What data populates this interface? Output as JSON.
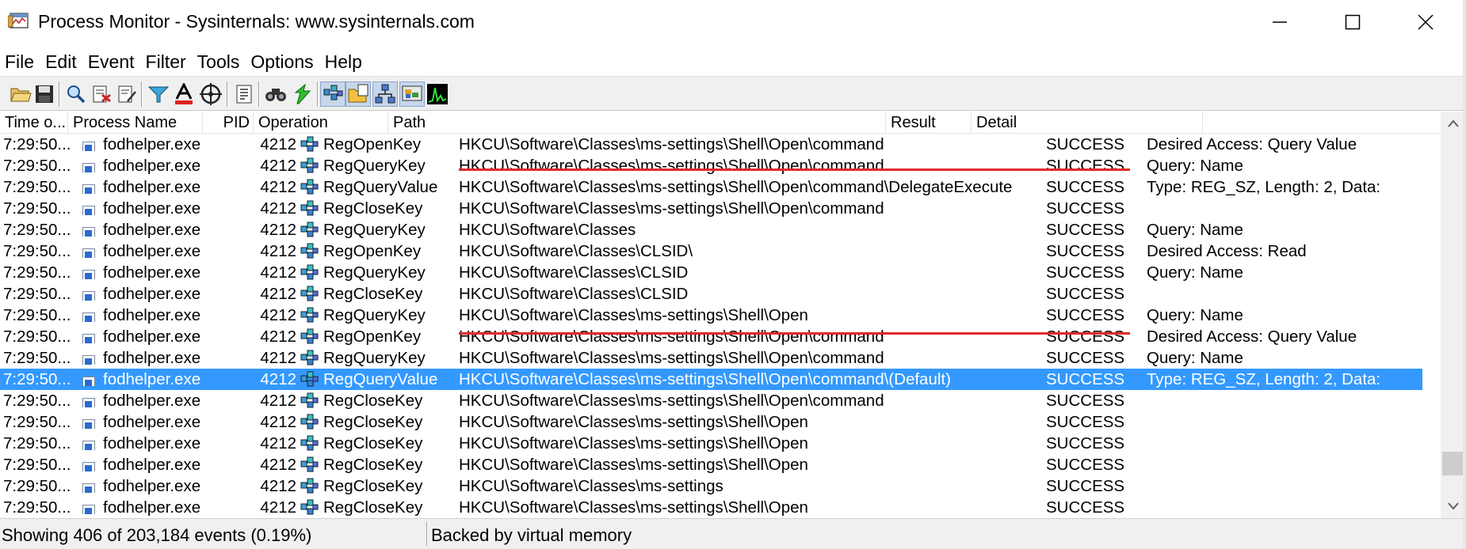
{
  "window": {
    "title": "Process Monitor - Sysinternals: www.sysinternals.com",
    "icon": "process-monitor-icon"
  },
  "menu": [
    "File",
    "Edit",
    "Event",
    "Filter",
    "Tools",
    "Options",
    "Help"
  ],
  "toolbar": {
    "buttons": [
      "open-icon",
      "save-icon",
      "capture-icon",
      "autoscroll-icon",
      "clear-icon",
      "filter-icon",
      "highlight-icon",
      "include-process-icon",
      "tree-icon",
      "find-icon",
      "jump-icon",
      "registry-activity-icon",
      "file-activity-icon",
      "network-activity-icon",
      "process-activity-icon",
      "profiling-icon"
    ]
  },
  "columns": {
    "time": "Time o...",
    "process": "Process Name",
    "pid": "PID",
    "operation": "Operation",
    "path": "Path",
    "result": "Result",
    "detail": "Detail"
  },
  "rows": [
    {
      "time": "7:29:50...",
      "process": "fodhelper.exe",
      "pid": "4212",
      "operation": "RegOpenKey",
      "path": "HKCU\\Software\\Classes\\ms-settings\\Shell\\Open\\command",
      "result": "SUCCESS",
      "detail": "Desired Access: Query Value"
    },
    {
      "time": "7:29:50...",
      "process": "fodhelper.exe",
      "pid": "4212",
      "operation": "RegQueryKey",
      "path": "HKCU\\Software\\Classes\\ms-settings\\Shell\\Open\\command",
      "result": "SUCCESS",
      "detail": "Query: Name"
    },
    {
      "time": "7:29:50...",
      "process": "fodhelper.exe",
      "pid": "4212",
      "operation": "RegQueryValue",
      "path": "HKCU\\Software\\Classes\\ms-settings\\Shell\\Open\\command\\DelegateExecute",
      "result": "SUCCESS",
      "detail": "Type: REG_SZ, Length: 2, Data:"
    },
    {
      "time": "7:29:50...",
      "process": "fodhelper.exe",
      "pid": "4212",
      "operation": "RegCloseKey",
      "path": "HKCU\\Software\\Classes\\ms-settings\\Shell\\Open\\command",
      "result": "SUCCESS",
      "detail": ""
    },
    {
      "time": "7:29:50...",
      "process": "fodhelper.exe",
      "pid": "4212",
      "operation": "RegQueryKey",
      "path": "HKCU\\Software\\Classes",
      "result": "SUCCESS",
      "detail": "Query: Name"
    },
    {
      "time": "7:29:50...",
      "process": "fodhelper.exe",
      "pid": "4212",
      "operation": "RegOpenKey",
      "path": "HKCU\\Software\\Classes\\CLSID\\",
      "result": "SUCCESS",
      "detail": "Desired Access: Read"
    },
    {
      "time": "7:29:50...",
      "process": "fodhelper.exe",
      "pid": "4212",
      "operation": "RegQueryKey",
      "path": "HKCU\\Software\\Classes\\CLSID",
      "result": "SUCCESS",
      "detail": "Query: Name"
    },
    {
      "time": "7:29:50...",
      "process": "fodhelper.exe",
      "pid": "4212",
      "operation": "RegCloseKey",
      "path": "HKCU\\Software\\Classes\\CLSID",
      "result": "SUCCESS",
      "detail": ""
    },
    {
      "time": "7:29:50...",
      "process": "fodhelper.exe",
      "pid": "4212",
      "operation": "RegQueryKey",
      "path": "HKCU\\Software\\Classes\\ms-settings\\Shell\\Open",
      "result": "SUCCESS",
      "detail": "Query: Name"
    },
    {
      "time": "7:29:50...",
      "process": "fodhelper.exe",
      "pid": "4212",
      "operation": "RegOpenKey",
      "path": "HKCU\\Software\\Classes\\ms-settings\\Shell\\Open\\command",
      "result": "SUCCESS",
      "detail": "Desired Access: Query Value"
    },
    {
      "time": "7:29:50...",
      "process": "fodhelper.exe",
      "pid": "4212",
      "operation": "RegQueryKey",
      "path": "HKCU\\Software\\Classes\\ms-settings\\Shell\\Open\\command",
      "result": "SUCCESS",
      "detail": "Query: Name"
    },
    {
      "time": "7:29:50...",
      "process": "fodhelper.exe",
      "pid": "4212",
      "operation": "RegQueryValue",
      "path": "HKCU\\Software\\Classes\\ms-settings\\Shell\\Open\\command\\(Default)",
      "result": "SUCCESS",
      "detail": "Type: REG_SZ, Length: 2, Data:",
      "selected": true
    },
    {
      "time": "7:29:50...",
      "process": "fodhelper.exe",
      "pid": "4212",
      "operation": "RegCloseKey",
      "path": "HKCU\\Software\\Classes\\ms-settings\\Shell\\Open\\command",
      "result": "SUCCESS",
      "detail": ""
    },
    {
      "time": "7:29:50...",
      "process": "fodhelper.exe",
      "pid": "4212",
      "operation": "RegCloseKey",
      "path": "HKCU\\Software\\Classes\\ms-settings\\Shell\\Open",
      "result": "SUCCESS",
      "detail": ""
    },
    {
      "time": "7:29:50...",
      "process": "fodhelper.exe",
      "pid": "4212",
      "operation": "RegCloseKey",
      "path": "HKCU\\Software\\Classes\\ms-settings\\Shell\\Open",
      "result": "SUCCESS",
      "detail": ""
    },
    {
      "time": "7:29:50...",
      "process": "fodhelper.exe",
      "pid": "4212",
      "operation": "RegCloseKey",
      "path": "HKCU\\Software\\Classes\\ms-settings\\Shell\\Open",
      "result": "SUCCESS",
      "detail": ""
    },
    {
      "time": "7:29:50...",
      "process": "fodhelper.exe",
      "pid": "4212",
      "operation": "RegCloseKey",
      "path": "HKCU\\Software\\Classes\\ms-settings",
      "result": "SUCCESS",
      "detail": ""
    },
    {
      "time": "7:29:50...",
      "process": "fodhelper.exe",
      "pid": "4212",
      "operation": "RegCloseKey",
      "path": "HKCU\\Software\\Classes\\ms-settings\\Shell\\Open",
      "result": "SUCCESS",
      "detail": ""
    }
  ],
  "status": {
    "events": "Showing 406 of 203,184 events (0.19%)",
    "memory": "Backed by virtual memory"
  },
  "colors": {
    "selection": "#3399ff",
    "annotation": "#e22a2a"
  }
}
